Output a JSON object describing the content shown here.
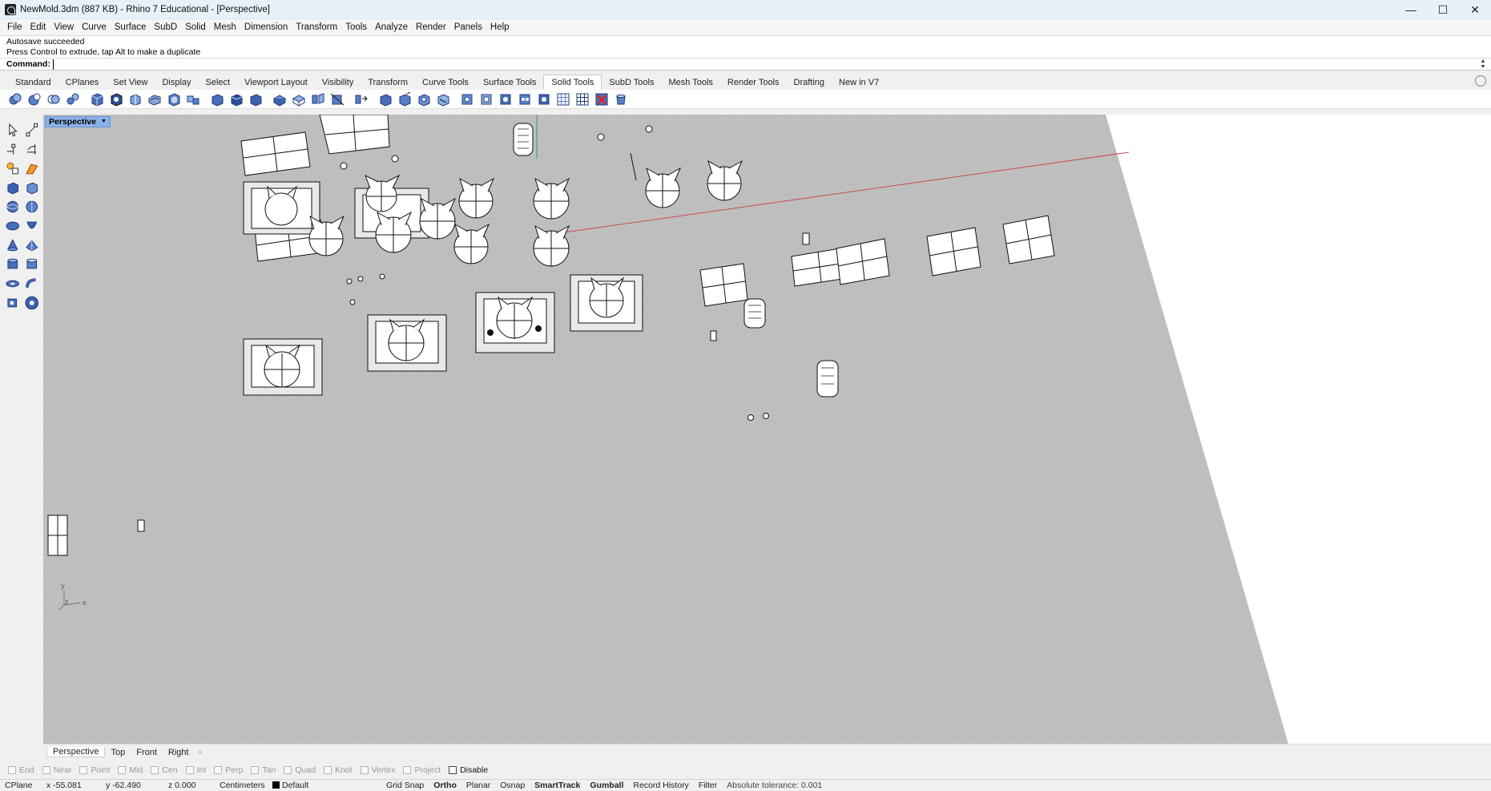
{
  "window": {
    "title": "NewMold.3dm (887 KB) - Rhino 7 Educational - [Perspective]",
    "minimize_icon": "minimize-icon",
    "maximize_icon": "maximize-icon",
    "close_icon": "close-icon"
  },
  "menu": [
    "File",
    "Edit",
    "View",
    "Curve",
    "Surface",
    "SubD",
    "Solid",
    "Mesh",
    "Dimension",
    "Transform",
    "Tools",
    "Analyze",
    "Render",
    "Panels",
    "Help"
  ],
  "command": {
    "history_line1": "Autosave succeeded",
    "history_line2": "Press Control to extrude, tap Alt to make a duplicate",
    "prompt_label": "Command:",
    "value": ""
  },
  "toolbar_tabs": [
    "Standard",
    "CPlanes",
    "Set View",
    "Display",
    "Select",
    "Viewport Layout",
    "Visibility",
    "Transform",
    "Curve Tools",
    "Surface Tools",
    "Solid Tools",
    "SubD Tools",
    "Mesh Tools",
    "Render Tools",
    "Drafting",
    "New in V7"
  ],
  "active_tab": "Solid Tools",
  "viewport": {
    "name": "Perspective",
    "axis_y": "y",
    "axis_x": "x",
    "axis_z": "z"
  },
  "viewport_tabs": [
    "Perspective",
    "Top",
    "Front",
    "Right"
  ],
  "osnaps": [
    "End",
    "Near",
    "Point",
    "Mid",
    "Cen",
    "Int",
    "Perp",
    "Tan",
    "Quad",
    "Knot",
    "Vertex",
    "Project"
  ],
  "osnap_disable": "Disable",
  "status": {
    "cplane": "CPlane",
    "x": "x -55.081",
    "y": "y -62.490",
    "z": "z 0.000",
    "units": "Centimeters",
    "layer": "Default",
    "grid_snap": "Grid Snap",
    "ortho": "Ortho",
    "planar": "Planar",
    "osnap": "Osnap",
    "smarttrack": "SmartTrack",
    "gumball": "Gumball",
    "record_history": "Record History",
    "filter": "Filter",
    "tolerance": "Absolute tolerance: 0.001"
  }
}
